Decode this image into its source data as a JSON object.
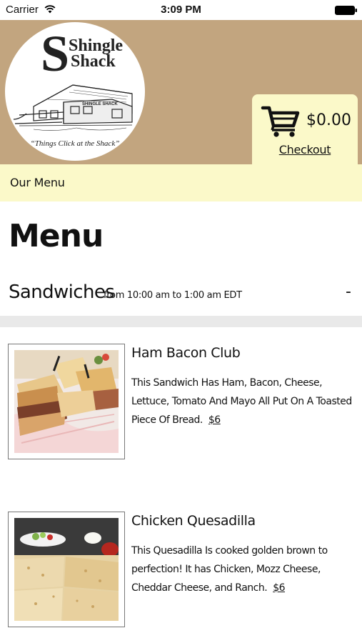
{
  "status_bar": {
    "carrier": "Carrier",
    "time": "3:09 PM"
  },
  "header": {
    "logo": {
      "brand_line_1": "Shingle",
      "brand_line_2": "Shack",
      "sign_text": "SHINGLE SHACK",
      "tagline": "“Things Click at the Shack”"
    },
    "cart": {
      "icon": "cart-icon",
      "total": "$0.00",
      "checkout_label": "Checkout"
    }
  },
  "nav": {
    "our_menu_label": "Our Menu"
  },
  "main": {
    "title": "Menu",
    "category": {
      "name": "Sandwiches",
      "hours": "from 10:00 am to 1:00 am EDT",
      "toggle": "-"
    },
    "items": [
      {
        "name": "Ham Bacon Club",
        "description": "This Sandwich Has Ham, Bacon, Cheese, Lettuce, Tomato And Mayo All Put On A Toasted Piece Of Bread.",
        "price": "$6"
      },
      {
        "name": "Chicken Quesadilla",
        "description": "This Quesadilla Is cooked golden brown to perfection! It has Chicken, Mozz Cheese, Cheddar Cheese, and Ranch.",
        "price": "$6"
      }
    ]
  },
  "colors": {
    "header_bg": "#c2a57f",
    "cream_bg": "#fbf9c9",
    "divider": "#e9e9e9"
  }
}
